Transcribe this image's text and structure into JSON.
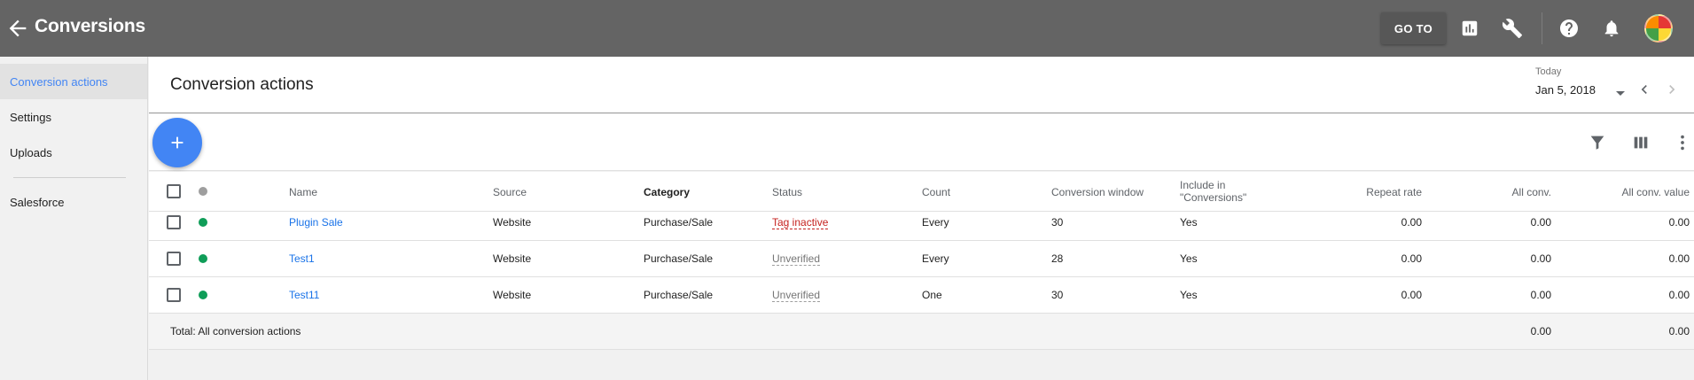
{
  "topbar": {
    "title": "Conversions",
    "goto_label": "GO TO",
    "icons": [
      "back-arrow-icon",
      "reports-icon",
      "tools-wrench-icon",
      "help-icon",
      "notifications-bell-icon"
    ]
  },
  "sidebar": {
    "items": [
      {
        "label": "Conversion actions",
        "active": true
      },
      {
        "label": "Settings"
      },
      {
        "label": "Uploads"
      },
      {
        "label": "Salesforce"
      }
    ]
  },
  "header": {
    "title": "Conversion actions",
    "date_label": "Today",
    "date_value": "Jan 5, 2018"
  },
  "table": {
    "columns": {
      "name": "Name",
      "source": "Source",
      "category": "Category",
      "status": "Status",
      "count": "Count",
      "window": "Conversion window",
      "include_line1": "Include in",
      "include_line2": "\"Conversions\"",
      "repeat": "Repeat rate",
      "all_conv": "All conv.",
      "all_value": "All conv. value"
    },
    "rows": [
      {
        "name": "Plugin Sale",
        "source": "Website",
        "category": "Purchase/Sale",
        "status": "Tag inactive",
        "count": "Every",
        "window": "30",
        "include": "Yes",
        "repeat": "0.00",
        "all_conv": "0.00",
        "all_value": "0.00"
      },
      {
        "name": "Test1",
        "source": "Website",
        "category": "Purchase/Sale",
        "status": "Unverified",
        "count": "Every",
        "window": "28",
        "include": "Yes",
        "repeat": "0.00",
        "all_conv": "0.00",
        "all_value": "0.00"
      },
      {
        "name": "Test11",
        "source": "Website",
        "category": "Purchase/Sale",
        "status": "Unverified",
        "count": "One",
        "window": "30",
        "include": "Yes",
        "repeat": "0.00",
        "all_conv": "0.00",
        "all_value": "0.00"
      }
    ],
    "total": {
      "label": "Total: All conversion actions",
      "all_conv": "0.00",
      "all_value": "0.00"
    }
  },
  "colors": {
    "topbar": "#646464",
    "accent_blue": "#4285f4",
    "status_green": "#0f9d58",
    "status_grey": "#9e9e9e",
    "inactive_red": "#c5221f"
  }
}
